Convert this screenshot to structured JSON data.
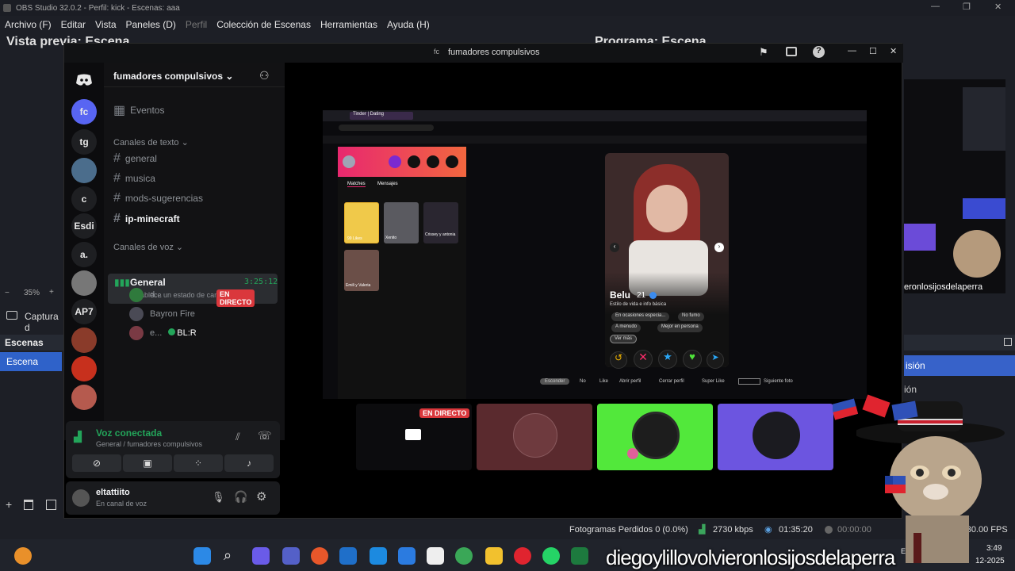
{
  "obs": {
    "title": "OBS Studio 32.0.2 - Perfil: kick - Escenas: aaa",
    "menu": [
      "Archivo (F)",
      "Editar",
      "Vista",
      "Paneles (D)",
      "Perfil",
      "Colección de Escenas",
      "Herramientas",
      "Ayuda (H)"
    ],
    "preview_label": "Vista previa: Escena",
    "program_label": "Programa: Escena",
    "zoom": "35%",
    "source_label": "Captura d",
    "scenes_header": "Escenas",
    "scene_item": "Escena",
    "right_items": [
      "isión",
      "ión"
    ],
    "status": {
      "dropped_frames": "Fotogramas Perdidos 0 (0.0%)",
      "bitrate": "2730 kbps",
      "stream_time": "01:35:20",
      "rec_time": "00:00:00",
      "fps": "30.00 / 30.00 FPS"
    }
  },
  "discord": {
    "window_title": "fumadores compulsivos",
    "server_name": "fumadores compulsivos",
    "events_label": "Eventos",
    "guilds": [
      "fc",
      "tg",
      "c",
      "Esdi",
      "a.",
      "AP7"
    ],
    "text_category": "Canales de texto",
    "text_channels": [
      "general",
      "musica",
      "mods-sugerencias",
      "ip-minecraft"
    ],
    "voice_category": "Canales de voz",
    "voice_channel": "General",
    "voice_timer": "3:25:12",
    "voice_status_placeholder": "Establece un estado de canal",
    "voice_users": [
      {
        "name": "d...",
        "badge": "EN DIRECTO"
      },
      {
        "name": "Bayron Fire",
        "badge": ""
      },
      {
        "name": "e...",
        "badge": "BL:R"
      }
    ],
    "voice_panel": {
      "title": "Voz conectada",
      "subtitle": "General / fumadores compulsivos"
    },
    "user": {
      "name": "eltattiito",
      "status": "En canal de voz"
    }
  },
  "stream": {
    "tabs": [
      "Matches",
      "Mensajes"
    ],
    "match_tiles": [
      "99 Likes",
      "Xenito",
      "Crissey y antonia",
      "Emili y Valeria"
    ],
    "profile": {
      "name": "Belu",
      "age": "21",
      "lifestyle": "Estilo de vida e info básica",
      "tags": [
        "En ocasiones especia...",
        "No fumo",
        "A menudo",
        "Mejor en persona",
        "Ver más"
      ]
    },
    "hints": [
      "Esconder",
      "No",
      "Like",
      "Abrir perfil",
      "Cerrar perfil",
      "Super Like",
      "Siguiente foto"
    ],
    "tile_badge": "EN DIRECTO"
  },
  "taskbar": {
    "time": "3:49",
    "date": "12-2025",
    "lang": "ESP"
  },
  "watermark": "diegoylillovolvieronlosijosdelaperra",
  "overlay_text": "eronlosijosdelaperra",
  "colors": {
    "accent_blue": "#2f62c9",
    "live_red": "#da373c",
    "voice_green": "#23a55a",
    "tile_green": "#52e83b",
    "tile_purple": "#6c55e0",
    "tile_maroon": "#5a2a2e"
  }
}
